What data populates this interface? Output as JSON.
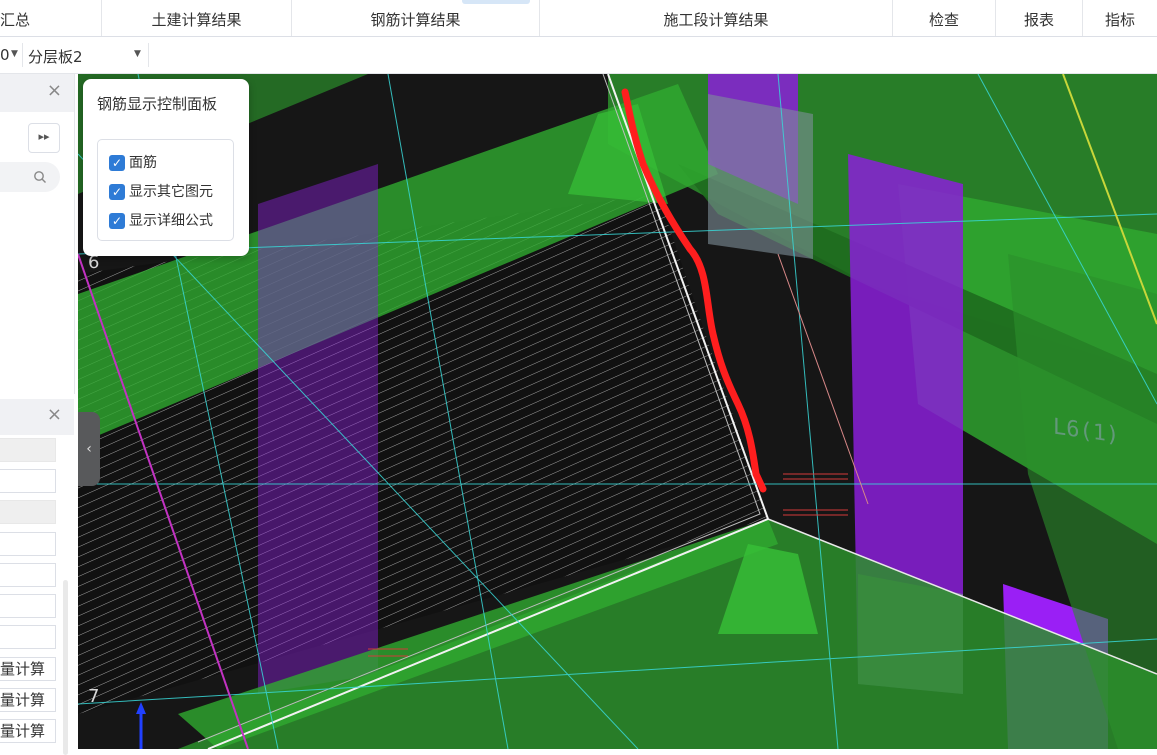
{
  "top_tabs": [
    "汇总",
    "土建计算结果",
    "钢筋计算结果",
    "施工段计算结果",
    "检查",
    "报表",
    "指标"
  ],
  "toolbar": {
    "floor_value": "0",
    "layer_value": "分层板2"
  },
  "left_panel": {
    "close_label": "×",
    "ff_label": "▸▸",
    "search_icon": "search-icon",
    "rows": [
      "",
      "",
      "",
      "",
      "",
      "",
      "",
      "量计算",
      "量计算",
      "量计算"
    ]
  },
  "viewport": {
    "axis_labels": [
      "6",
      "7"
    ],
    "beam_label": "L6(1)",
    "colors": {
      "background": "#161616",
      "green": "#2faa2f",
      "purple": "#8a1fd8",
      "cyan": "#39d8d8",
      "annotation": "#ff1e1e"
    }
  },
  "control_panel": {
    "title": "钢筋显示控制面板",
    "options": [
      {
        "label": "面筋",
        "checked": true
      },
      {
        "label": "显示其它图元",
        "checked": true
      },
      {
        "label": "显示详细公式",
        "checked": true
      }
    ]
  }
}
